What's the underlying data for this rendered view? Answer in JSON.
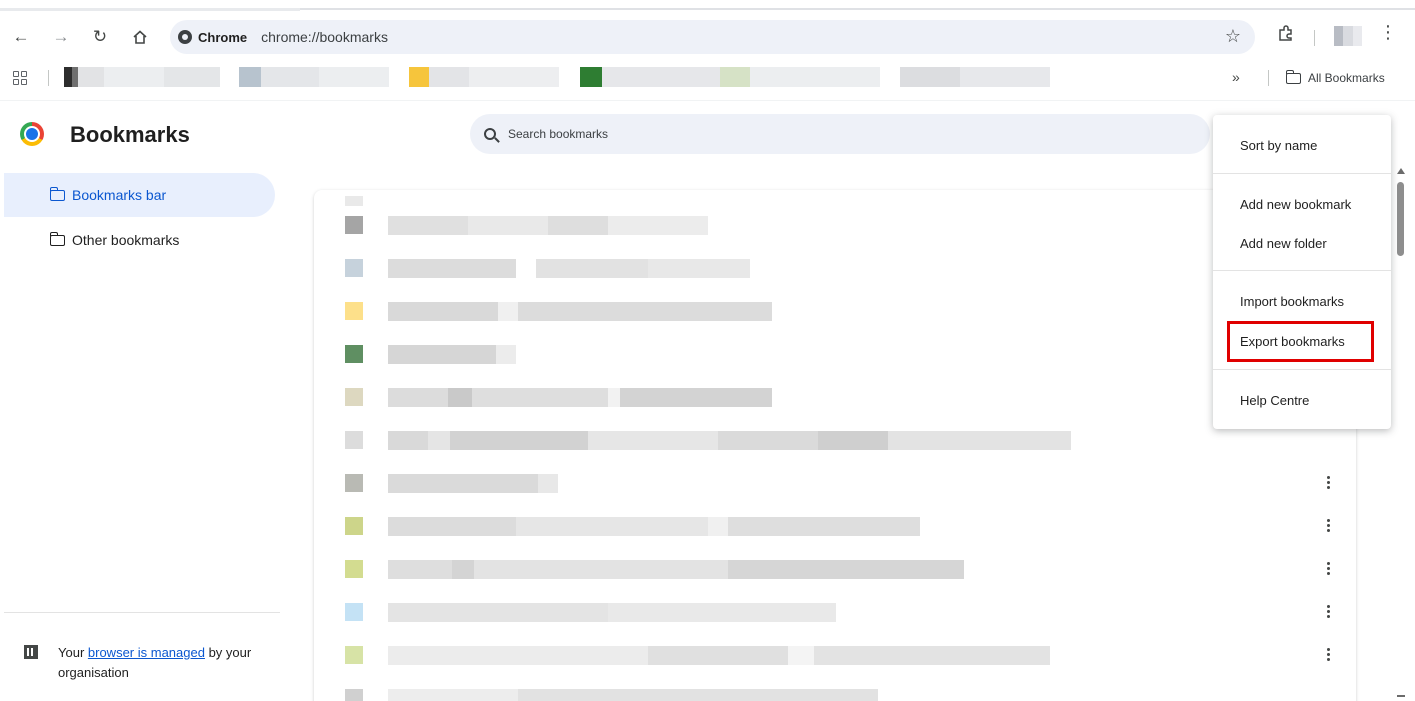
{
  "toolbar": {
    "back_icon": "arrow-left-icon",
    "forward_icon": "arrow-right-icon",
    "reload_icon": "reload-icon",
    "home_icon": "home-icon",
    "site_chip": "Chrome",
    "url": "chrome://bookmarks",
    "bookmark_star_icon": "star-icon",
    "extensions_icon": "puzzle-icon",
    "menu_icon": "kebab-menu-icon"
  },
  "bookmarks_bar": {
    "apps_icon": "apps-grid-icon",
    "overflow_label": "»",
    "all_bookmarks_label": "All Bookmarks"
  },
  "header": {
    "title": "Bookmarks",
    "search_placeholder": "Search bookmarks"
  },
  "sidebar": {
    "items": [
      {
        "label": "Bookmarks bar",
        "selected": true
      },
      {
        "label": "Other bookmarks",
        "selected": false
      }
    ],
    "managed": {
      "prefix": "Your ",
      "link": "browser is managed",
      "suffix": " by your organisation"
    }
  },
  "menu": {
    "items": [
      {
        "label": "Sort by name"
      },
      {
        "label": "Add new bookmark"
      },
      {
        "label": "Add new folder"
      },
      {
        "label": "Import bookmarks"
      },
      {
        "label": "Export bookmarks",
        "highlighted": true
      },
      {
        "label": "Help Centre"
      }
    ],
    "highlight_color": "#e00000"
  },
  "colors": {
    "accent": "#0b57d0",
    "selected_bg": "#e8effd",
    "omnibox_bg": "#eef1f8"
  }
}
